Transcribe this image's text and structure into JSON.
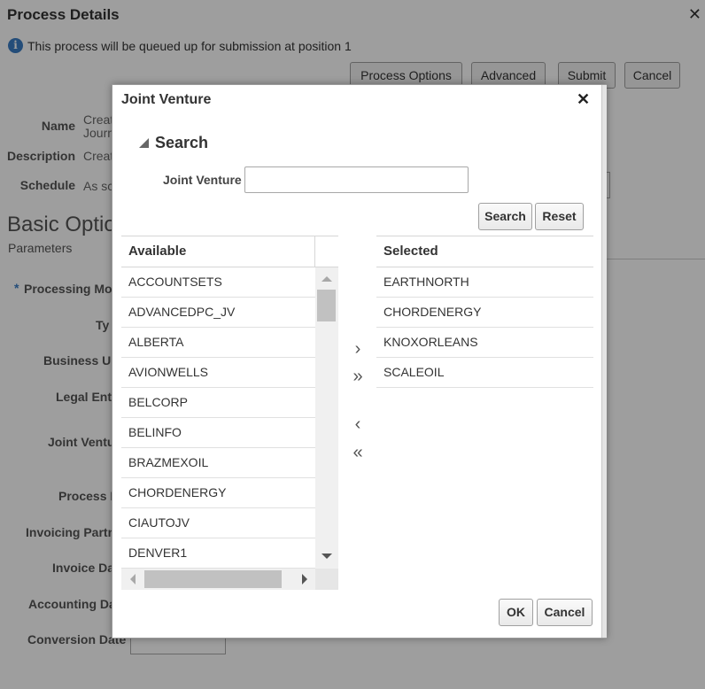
{
  "background": {
    "title": "Process Details",
    "info_text": "This process will be queued up for submission at position 1",
    "buttons": [
      "Process Options",
      "Advanced",
      "Submit",
      "Cancel"
    ],
    "fields": [
      {
        "label": "Name",
        "value": "Creat"
      },
      {
        "label": "Description",
        "value": "Creat"
      },
      {
        "label": "Schedule",
        "value": "As sc"
      }
    ],
    "name_value_line2": "Journ",
    "section_heading": "Basic Optio",
    "section_sub": "Parameters",
    "required_mark": "*",
    "param_labels": [
      "Processing Mo",
      "Ty",
      "Business Ur",
      "Legal Enti",
      "Joint Ventu",
      "Process I",
      "Invoicing Partn",
      "Invoice Da",
      "Accounting Da",
      "Conversion Date"
    ]
  },
  "dialog": {
    "title": "Joint Venture",
    "search": {
      "header": "Search",
      "field_label": "Joint Venture",
      "field_value": "",
      "search_button": "Search",
      "reset_button": "Reset"
    },
    "available": {
      "header": "Available",
      "items": [
        "ACCOUNTSETS",
        "ADVANCEDPC_JV",
        "ALBERTA",
        "AVIONWELLS",
        "BELCORP",
        "BELINFO",
        "BRAZMEXOIL",
        "CHORDENERGY",
        "CIAUTOJV",
        "DENVER1"
      ]
    },
    "selected": {
      "header": "Selected",
      "items": [
        "EARTHNORTH",
        "CHORDENERGY",
        "KNOXORLEANS",
        "SCALEOIL"
      ]
    },
    "move_buttons": {
      "move": "›",
      "move_all": "»",
      "remove": "‹",
      "remove_all": "«"
    },
    "ok_button": "OK",
    "cancel_button": "Cancel"
  }
}
